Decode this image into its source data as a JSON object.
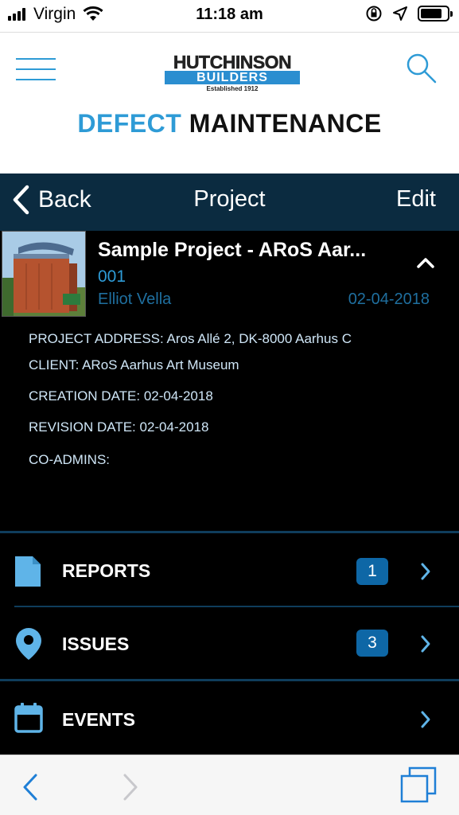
{
  "status_bar": {
    "carrier": "Virgin",
    "time": "11:18 am",
    "battery_level": 0.8
  },
  "header": {
    "logo": {
      "line1": "HUTCHINSON",
      "line2": "BUILDERS",
      "line3": "Established 1912"
    },
    "title_part1": "DEFECT",
    "title_part2": "MAINTENANCE",
    "accent_color": "#2e9bd6"
  },
  "navbar": {
    "back_label": "Back",
    "title": "Project",
    "edit_label": "Edit"
  },
  "project": {
    "name": "Sample Project - ARoS Aar...",
    "number": "001",
    "owner": "Elliot Vella",
    "date": "02-04-2018",
    "address": "PROJECT ADDRESS: Aros Allé 2, DK-8000 Aarhus C",
    "client": "CLIENT: ARoS Aarhus Art Museum",
    "creation_date": "CREATION DATE: 02-04-2018",
    "revision_date": "REVISION DATE: 02-04-2018",
    "co_admins": "CO-ADMINS:"
  },
  "menu": [
    {
      "label": "REPORTS",
      "count": "1",
      "icon": "document-icon"
    },
    {
      "label": "ISSUES",
      "count": "3",
      "icon": "map-pin-icon"
    },
    {
      "label": "EVENTS",
      "count": "",
      "icon": "calendar-icon"
    }
  ],
  "toolbar": {
    "icons": [
      "back-arrow-icon",
      "forward-arrow-icon",
      "tabs-icon"
    ]
  }
}
